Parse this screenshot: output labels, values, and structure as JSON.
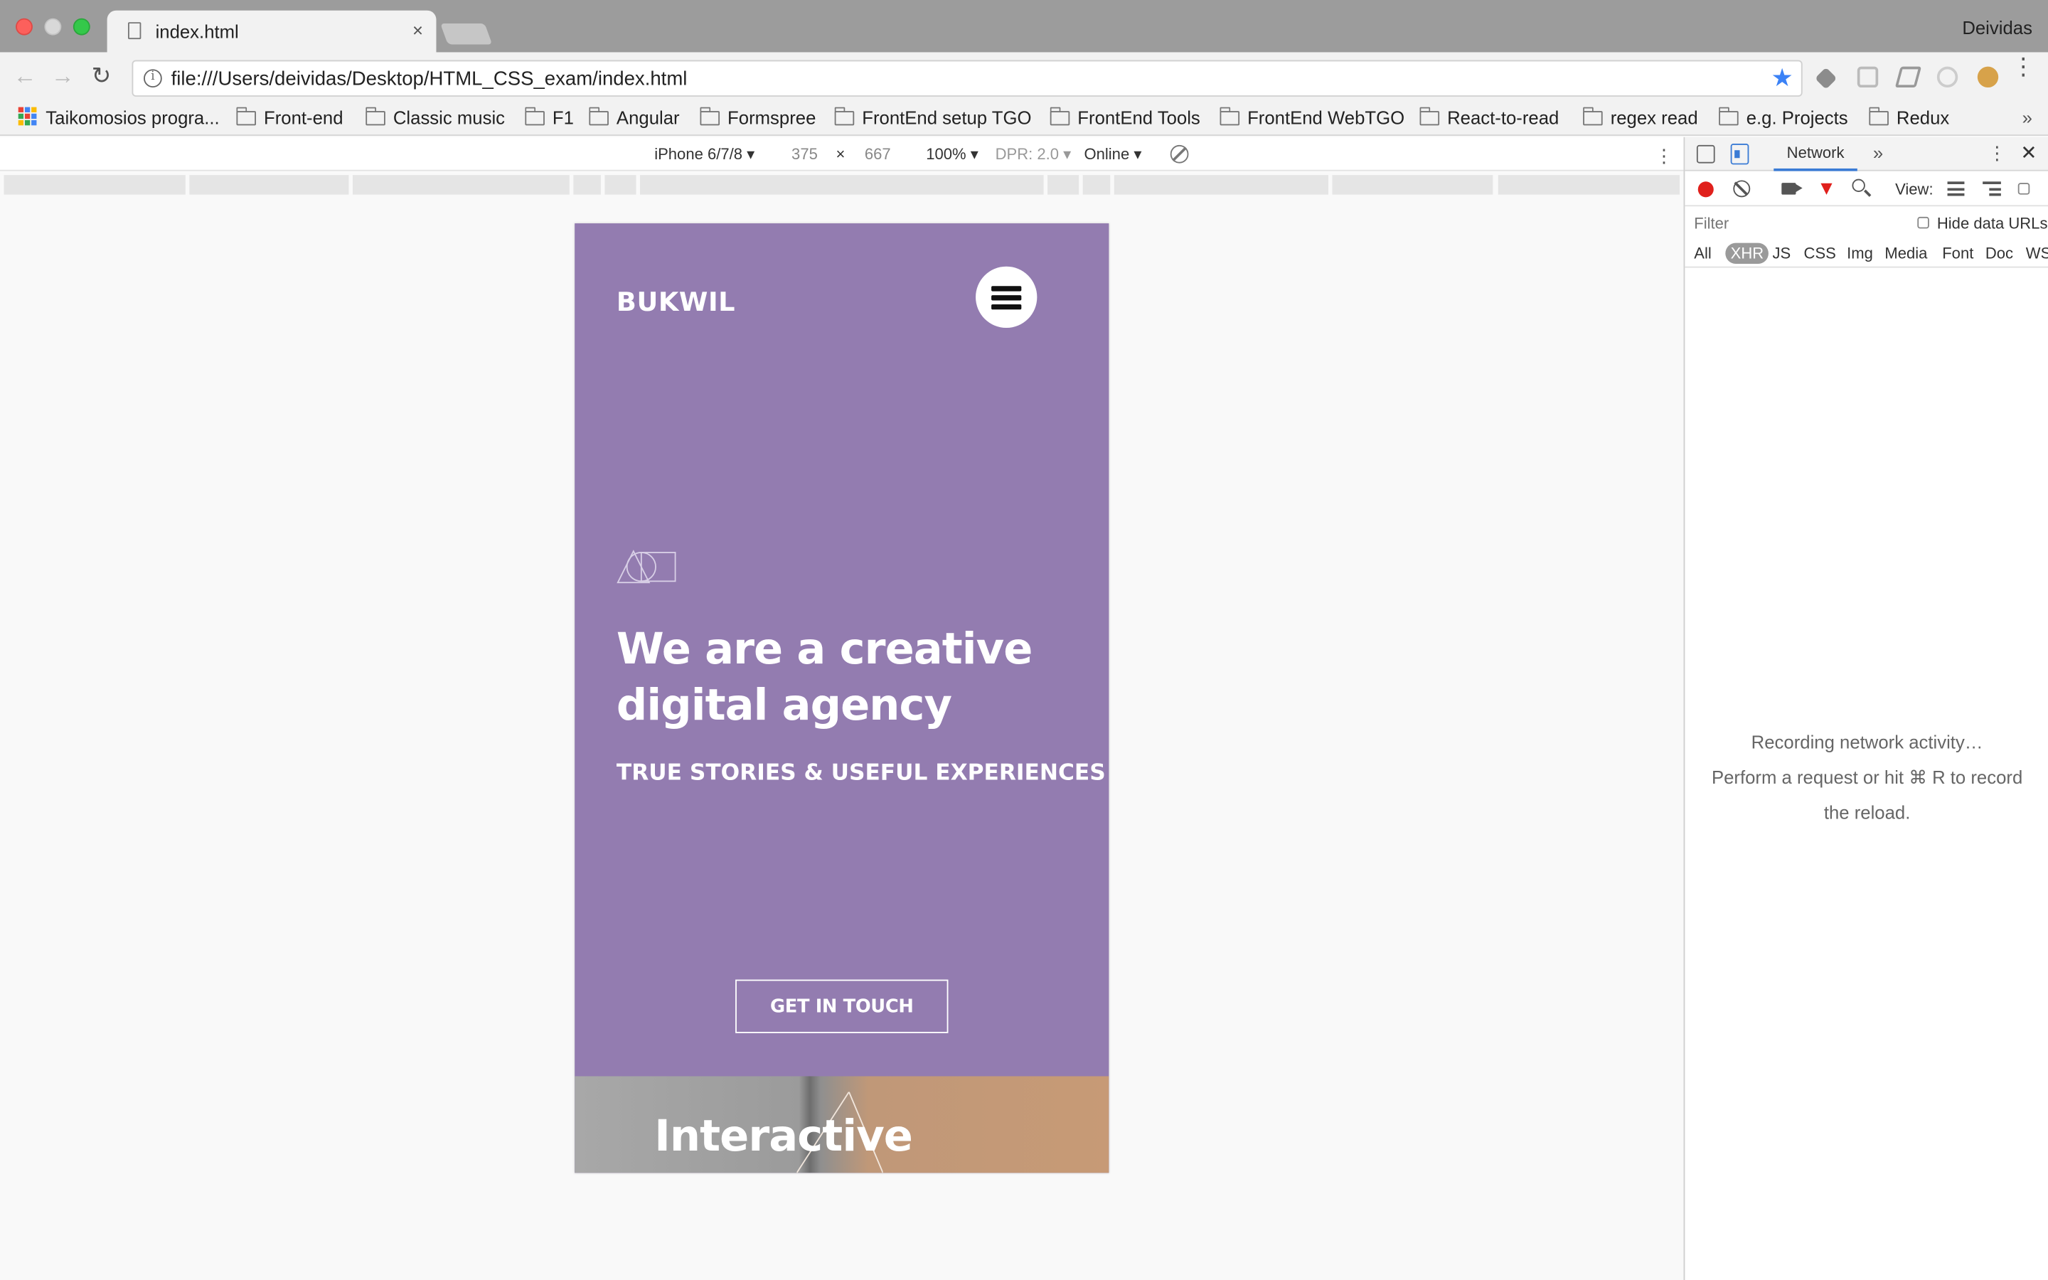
{
  "browser": {
    "tab_title": "index.html",
    "tab_close": "×",
    "profile_name": "Deividas",
    "url": "file:///Users/deividas/Desktop/HTML_CSS_exam/index.html",
    "info_glyph": "i",
    "star_glyph": "★",
    "back_glyph": "←",
    "forward_glyph": "→",
    "reload_glyph": "↻",
    "menu_glyph": "⋮"
  },
  "bookmarks": {
    "items": [
      {
        "label": "Taikomosios progra..."
      },
      {
        "label": "Front-end"
      },
      {
        "label": "Classic music"
      },
      {
        "label": "F1"
      },
      {
        "label": "Angular"
      },
      {
        "label": "Formspree"
      },
      {
        "label": "FrontEnd setup TGO"
      },
      {
        "label": "FrontEnd Tools"
      },
      {
        "label": "FrontEnd WebTGO"
      },
      {
        "label": "React-to-read"
      },
      {
        "label": "regex read"
      },
      {
        "label": "e.g. Projects"
      },
      {
        "label": "Redux"
      }
    ],
    "overflow_glyph": "»"
  },
  "device_toolbar": {
    "device": "iPhone 6/7/8 ▾",
    "width": "375",
    "times": "×",
    "height": "667",
    "zoom": "100% ▾",
    "dpr": "DPR: 2.0 ▾",
    "network": "Online ▾",
    "kebab": "⋮"
  },
  "site": {
    "brand": "BUKWIL",
    "headline": "We are a creative digital agency",
    "tagline": "TRUE STORIES & USEFUL EXPERIENCES",
    "cta_label": "GET IN TOUCH",
    "next_section_title": "Interactive",
    "colors": {
      "hero_bg": "#937cb0",
      "text": "#ffffff"
    }
  },
  "devtools": {
    "tab_network": "Network",
    "more_tabs": "»",
    "kebab": "⋮",
    "close": "✕",
    "funnel_glyph": "▼",
    "view_label": "View:",
    "filter_placeholder": "Filter",
    "hide_data_urls": "Hide data URLs",
    "filter_types": [
      {
        "label": "All",
        "active": false
      },
      {
        "label": "XHR",
        "active": true
      },
      {
        "label": "JS",
        "active": false
      },
      {
        "label": "CSS",
        "active": false
      },
      {
        "label": "Img",
        "active": false
      },
      {
        "label": "Media",
        "active": false
      },
      {
        "label": "Font",
        "active": false
      },
      {
        "label": "Doc",
        "active": false
      },
      {
        "label": "WS",
        "active": false
      }
    ],
    "empty_line1": "Recording network activity…",
    "empty_line2": "Perform a request or hit ⌘ R to record",
    "empty_line3": "the reload."
  }
}
